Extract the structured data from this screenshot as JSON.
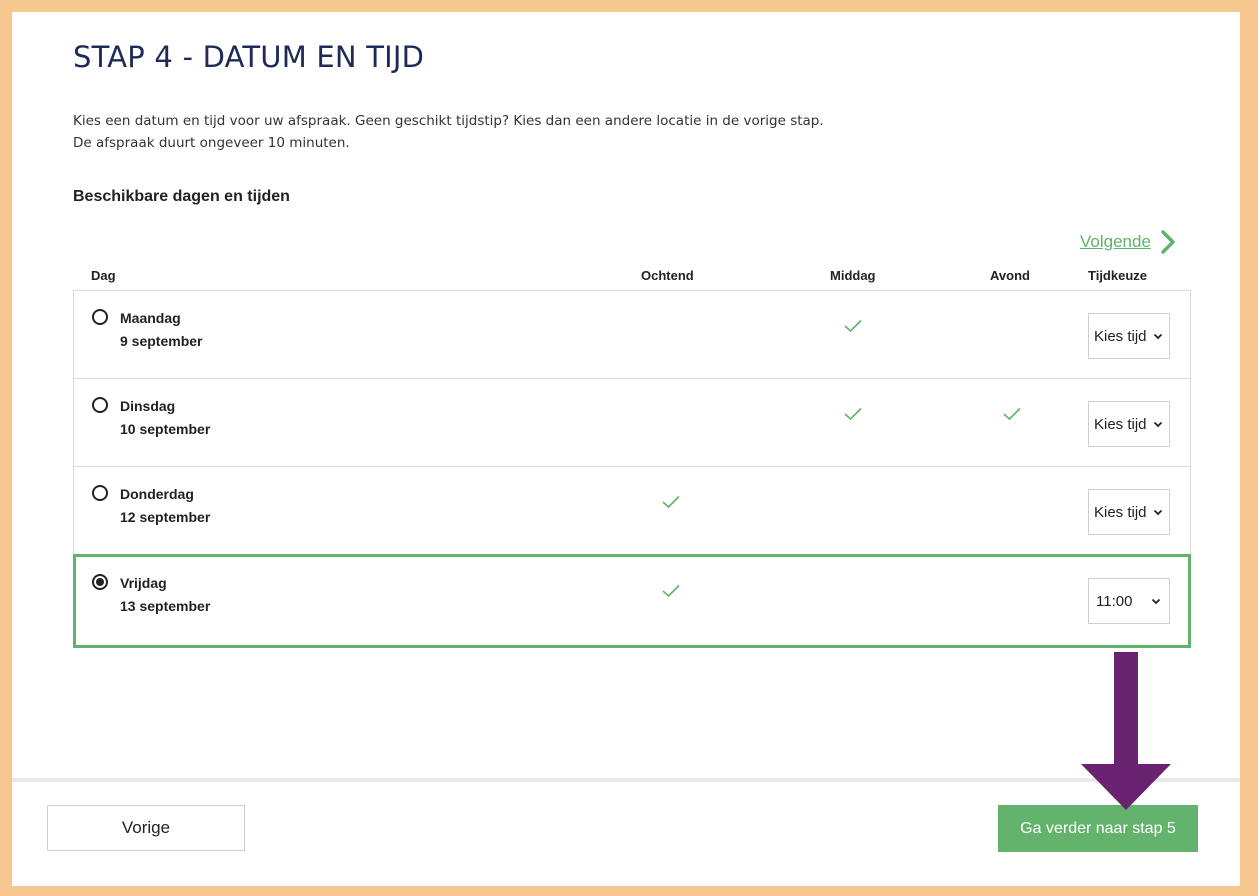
{
  "page": {
    "title": "STAP 4 - DATUM EN TIJD",
    "intro_line1": "Kies een datum en tijd voor uw afspraak. Geen geschikt tijdstip? Kies dan een andere locatie in de vorige stap.",
    "intro_line2": "De afspraak duurt ongeveer 10 minuten.",
    "subheading": "Beschikbare dagen en tijden",
    "next_link": "Volgende"
  },
  "table": {
    "headers": {
      "day": "Dag",
      "morning": "Ochtend",
      "afternoon": "Middag",
      "evening": "Avond",
      "time_choice": "Tijdkeuze"
    },
    "rows": [
      {
        "day": "Maandag",
        "date": "9 september",
        "morning": false,
        "afternoon": true,
        "evening": false,
        "time": "Kies tijd",
        "selected": false
      },
      {
        "day": "Dinsdag",
        "date": "10 september",
        "morning": false,
        "afternoon": true,
        "evening": true,
        "time": "Kies tijd",
        "selected": false
      },
      {
        "day": "Donderdag",
        "date": "12 september",
        "morning": true,
        "afternoon": false,
        "evening": false,
        "time": "Kies tijd",
        "selected": false
      },
      {
        "day": "Vrijdag",
        "date": "13 september",
        "morning": true,
        "afternoon": false,
        "evening": false,
        "time": "11:00",
        "selected": true
      }
    ]
  },
  "footer": {
    "prev_label": "Vorige",
    "next_label": "Ga verder naar stap 5"
  },
  "icons": {
    "next_link": "chevron-right-icon",
    "availability": "check-icon",
    "select": "chevron-down-icon",
    "annotation": "arrow-down-icon"
  },
  "colors": {
    "accent_green": "#5fb36a",
    "button_green": "#64b36d",
    "frame_orange": "#f6c78f",
    "title_navy": "#1e2a5a",
    "annotation_purple": "#6a2370"
  }
}
